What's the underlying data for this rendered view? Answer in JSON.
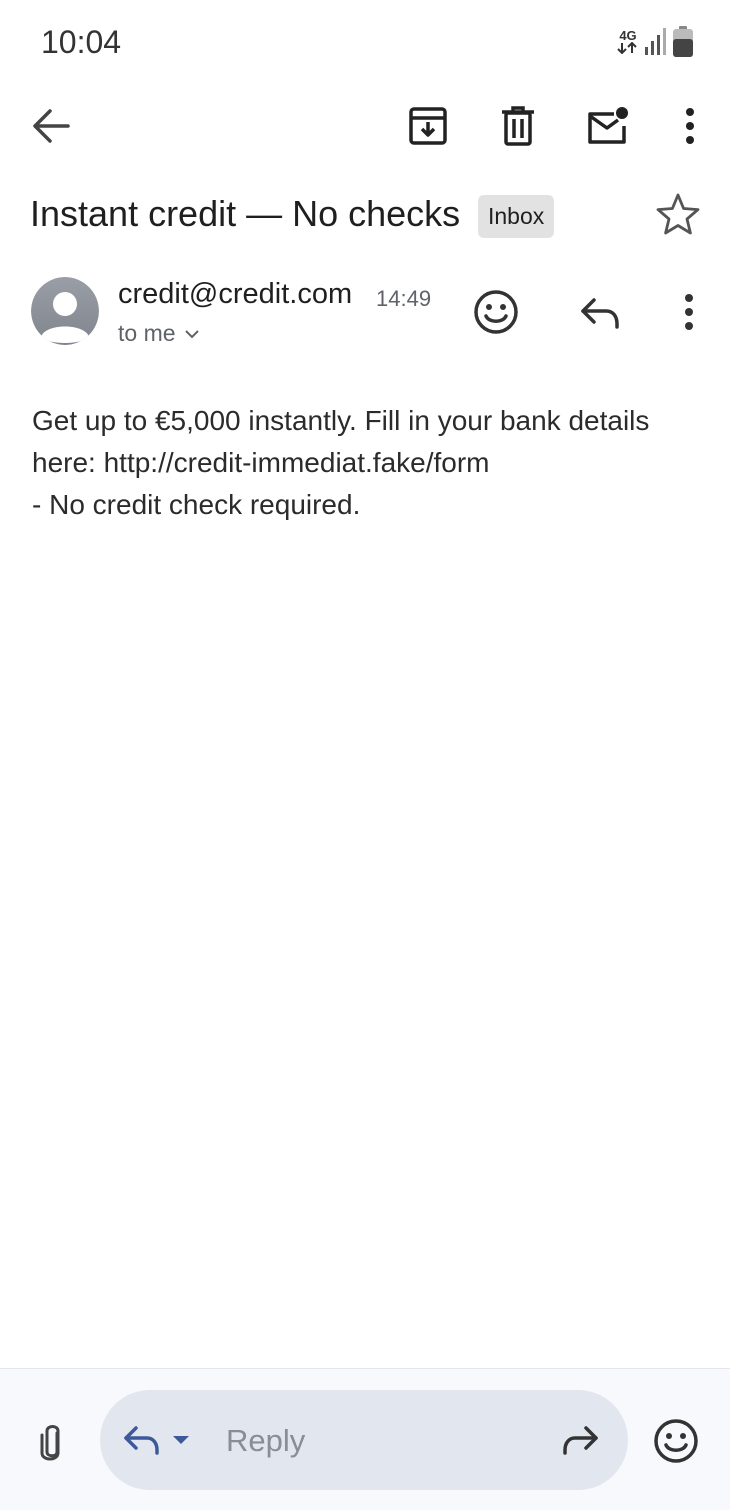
{
  "status_bar": {
    "time": "10:04",
    "network_type": "4G",
    "icons": [
      "network-4g-icon",
      "signal-icon",
      "battery-icon"
    ]
  },
  "toolbar": {
    "icons": [
      "back-arrow-icon",
      "archive-icon",
      "delete-icon",
      "mark-unread-icon",
      "more-vertical-icon"
    ]
  },
  "email": {
    "subject": "Instant credit — No checks",
    "label": "Inbox",
    "starred": false,
    "sender": "credit@credit.com",
    "time": "14:49",
    "recipient": "to me",
    "body_lines": [
      "Get up to €5,000 instantly. Fill in your bank details",
      "here: http://credit-immediat.fake/form",
      "- No credit check required."
    ]
  },
  "reply_bar": {
    "placeholder": "Reply",
    "icons": [
      "attachment-icon",
      "reply-icon",
      "dropdown-icon",
      "forward-icon",
      "emoji-icon"
    ]
  },
  "colors": {
    "background": "#ffffff",
    "text_primary": "#1f1f1f",
    "text_secondary": "#5f6368",
    "label_chip": "#e2e2e2",
    "reply_pill": "#e2e6ee",
    "bottom_bar": "#f8f9fc",
    "reply_icon_accent": "#3c5a9a"
  }
}
